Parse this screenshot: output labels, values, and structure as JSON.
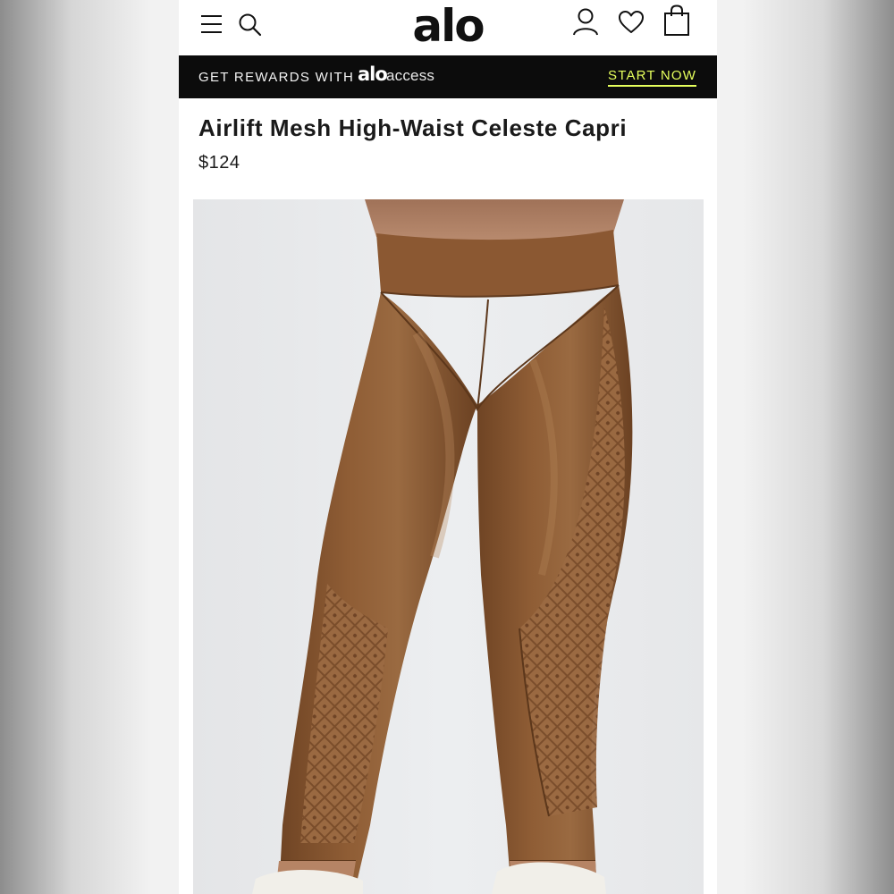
{
  "brand": {
    "logo_text": "alo"
  },
  "header": {
    "icons": [
      "hamburger-menu-icon",
      "search-icon",
      "account-icon",
      "wishlist-heart-icon",
      "shopping-bag-icon"
    ]
  },
  "banner": {
    "text": "GET REWARDS WITH",
    "logo_text": "alo",
    "access_text": "access",
    "cta_label": "START NOW",
    "cta_color": "#e6ff5c",
    "background": "#0c0c0c"
  },
  "product": {
    "title": "Airlift Mesh High-Waist Celeste Capri",
    "price": "$124",
    "color_swatch": "#8a5a36"
  }
}
